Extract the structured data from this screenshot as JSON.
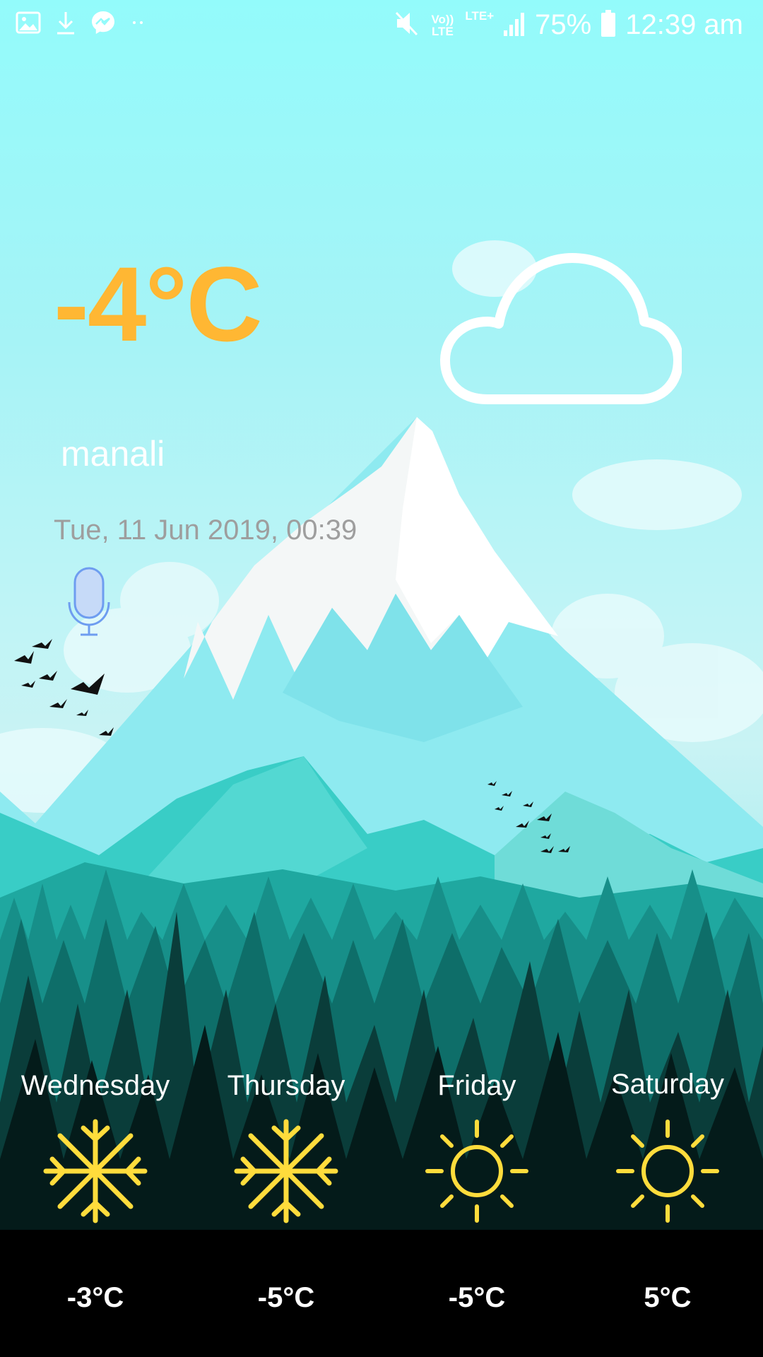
{
  "status_bar": {
    "left_icons": [
      "gallery-icon",
      "download-icon",
      "messenger-icon",
      "more-notifications-icon"
    ],
    "volte_label": "Vo)) LTE",
    "lte_label": "LTE+",
    "battery_percent": "75%",
    "time": "12:39 am"
  },
  "current": {
    "temperature": "-4°C",
    "condition_icon": "cloud-icon",
    "location": "manali",
    "datetime": "Tue, 11 Jun 2019, 00:39",
    "mic_icon": "microphone-icon"
  },
  "forecast": [
    {
      "day": "Wednesday",
      "icon": "snowflake-icon",
      "temp": "-3°C"
    },
    {
      "day": "Thursday",
      "icon": "snowflake-icon",
      "temp": "-5°C"
    },
    {
      "day": "Friday",
      "icon": "sun-icon",
      "temp": "-5°C"
    },
    {
      "day": "Saturday",
      "icon": "sun-icon",
      "temp": "5°C"
    }
  ],
  "colors": {
    "temperature": "#ffb733",
    "forecast_icon": "#ffdc3c",
    "datetime": "#9e9e9e",
    "mic": "#6e9df0"
  }
}
